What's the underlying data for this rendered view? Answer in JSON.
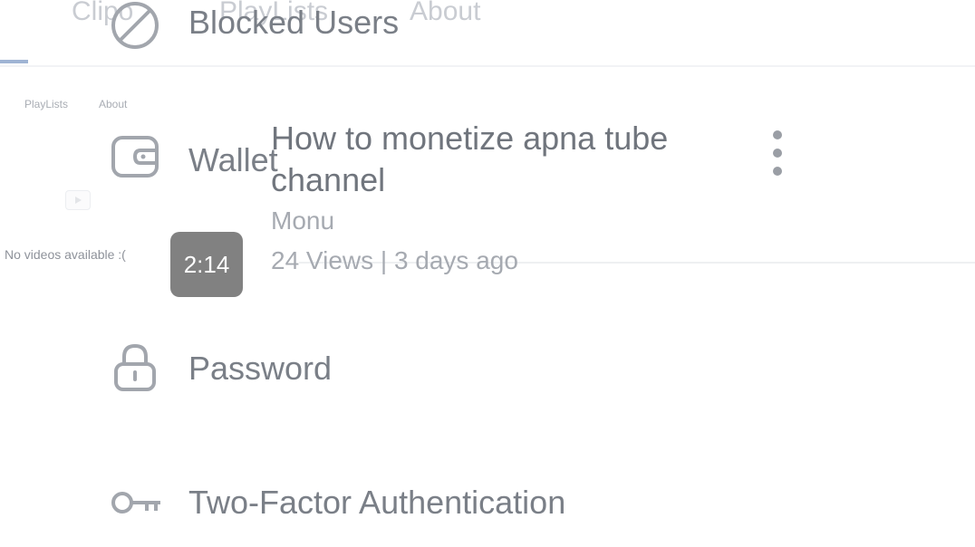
{
  "background_tabs": {
    "big": [
      "Clipo",
      "PlayLists",
      "About"
    ],
    "small": [
      "PlayLists",
      "About"
    ],
    "empty_state": "No videos available :("
  },
  "settings_menu": {
    "items": [
      {
        "label": "Blocked Users",
        "icon": "blocked-icon"
      },
      {
        "label": "Wallet",
        "icon": "wallet-icon"
      },
      {
        "label": "Password",
        "icon": "lock-icon"
      },
      {
        "label": "Two-Factor Authentication",
        "icon": "key-icon"
      }
    ]
  },
  "video": {
    "title": "How to monetize apna tube channel",
    "author": "Monu",
    "meta": "24 Views | 3 days ago",
    "duration": "2:14",
    "menu_icon": "more-vertical-icon"
  },
  "colors": {
    "text_primary": "#70757d",
    "text_secondary": "#a6aab1",
    "badge": "#7b7b7b",
    "accent_underline": "#9fb4d4"
  }
}
